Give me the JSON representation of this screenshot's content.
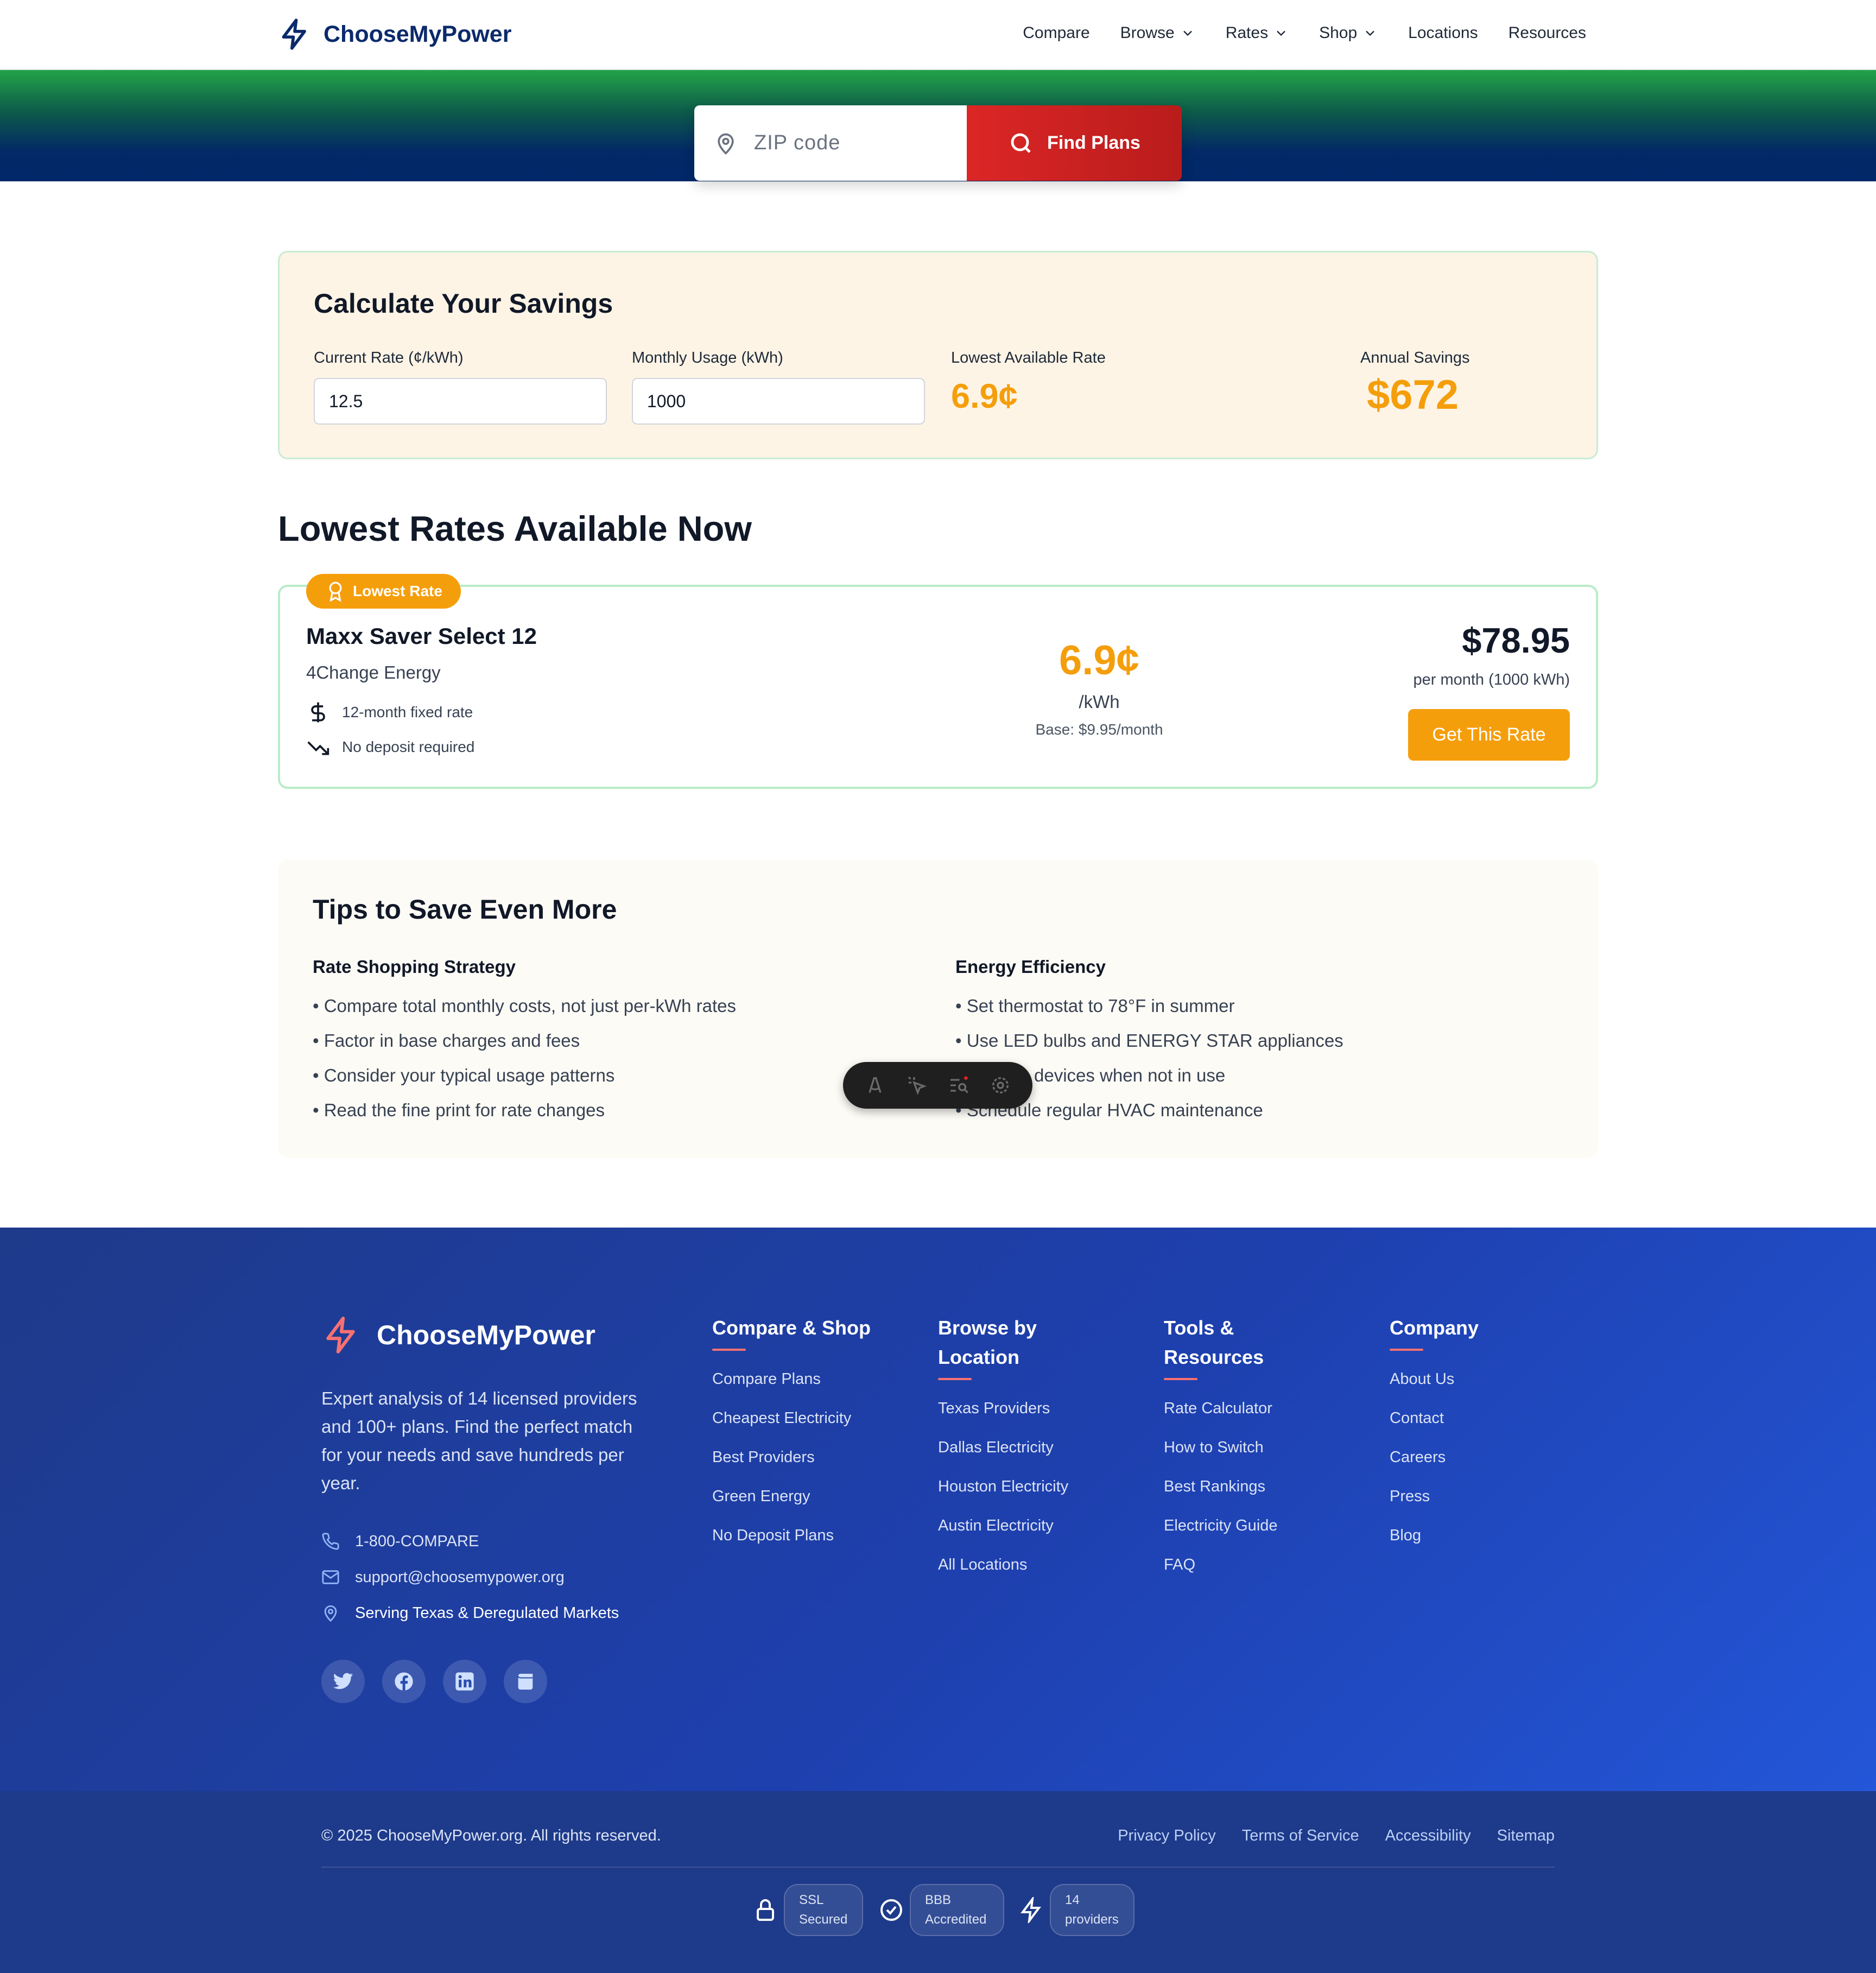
{
  "header": {
    "brand": "ChooseMyPower",
    "nav": [
      {
        "label": "Compare",
        "dropdown": false
      },
      {
        "label": "Browse",
        "dropdown": true
      },
      {
        "label": "Rates",
        "dropdown": true
      },
      {
        "label": "Shop",
        "dropdown": true
      },
      {
        "label": "Locations",
        "dropdown": false
      },
      {
        "label": "Resources",
        "dropdown": false
      }
    ]
  },
  "hero": {
    "zip_placeholder": "ZIP code",
    "zip_value": "",
    "find_button": "Find Plans"
  },
  "calculator": {
    "title": "Calculate Your Savings",
    "current_rate_label": "Current Rate (¢/kWh)",
    "current_rate_value": "12.5",
    "usage_label": "Monthly Usage (kWh)",
    "usage_value": "1000",
    "lowest_label": "Lowest Available Rate",
    "lowest_value": "6.9¢",
    "savings_label": "Annual Savings",
    "savings_value": "$672"
  },
  "rates": {
    "title": "Lowest Rates Available Now",
    "badge": "Lowest Rate",
    "plan_name": "Maxx Saver Select 12",
    "provider": "4Change Energy",
    "features": [
      "12-month fixed rate",
      "No deposit required"
    ],
    "rate": "6.9¢",
    "rate_unit": "/kWh",
    "base": "Base: $9.95/month",
    "price": "$78.95",
    "price_sub": "per month (1000 kWh)",
    "cta": "Get This Rate"
  },
  "tips": {
    "title": "Tips to Save Even More",
    "col1_title": "Rate Shopping Strategy",
    "col1": [
      "• Compare total monthly costs, not just per-kWh rates",
      "• Factor in base charges and fees",
      "• Consider your typical usage patterns",
      "• Read the fine print for rate changes"
    ],
    "col2_title": "Energy Efficiency",
    "col2": [
      "• Set thermostat to 78°F in summer",
      "• Use LED bulbs and ENERGY STAR appliances",
      "devices when not in use",
      "• Schedule regular HVAC maintenance"
    ]
  },
  "footer": {
    "brand": "ChooseMyPower",
    "description": "Expert analysis of 14 licensed providers and 100+ plans. Find the perfect match for your needs and save hundreds per year.",
    "phone": "1-800-COMPARE",
    "email": "support@choosemypower.org",
    "service_area": "Serving Texas & Deregulated Markets",
    "socials": [
      "twitter-icon",
      "facebook-icon",
      "linkedin-icon",
      "blog-icon"
    ],
    "columns": [
      {
        "title": "Compare & Shop",
        "links": [
          "Compare Plans",
          "Cheapest Electricity",
          "Best Providers",
          "Green Energy",
          "No Deposit Plans"
        ]
      },
      {
        "title": "Browse by Location",
        "links": [
          "Texas Providers",
          "Dallas Electricity",
          "Houston Electricity",
          "Austin Electricity",
          "All Locations"
        ]
      },
      {
        "title": "Tools & Resources",
        "links": [
          "Rate Calculator",
          "How to Switch",
          "Best Rankings",
          "Electricity Guide",
          "FAQ"
        ]
      },
      {
        "title": "Company",
        "links": [
          "About Us",
          "Contact",
          "Careers",
          "Press",
          "Blog"
        ]
      }
    ],
    "copyright": "© 2025 ChooseMyPower.org. All rights reserved.",
    "legal": [
      "Privacy Policy",
      "Terms of Service",
      "Accessibility",
      "Sitemap"
    ],
    "trust": [
      "SSL Secured",
      "BBB Accredited",
      "14 providers"
    ]
  },
  "colors": {
    "brand_navy": "#0b2a6b",
    "accent_orange": "#f59e0b",
    "find_red": "#dc2626",
    "footer_blue": "#1e40af"
  }
}
